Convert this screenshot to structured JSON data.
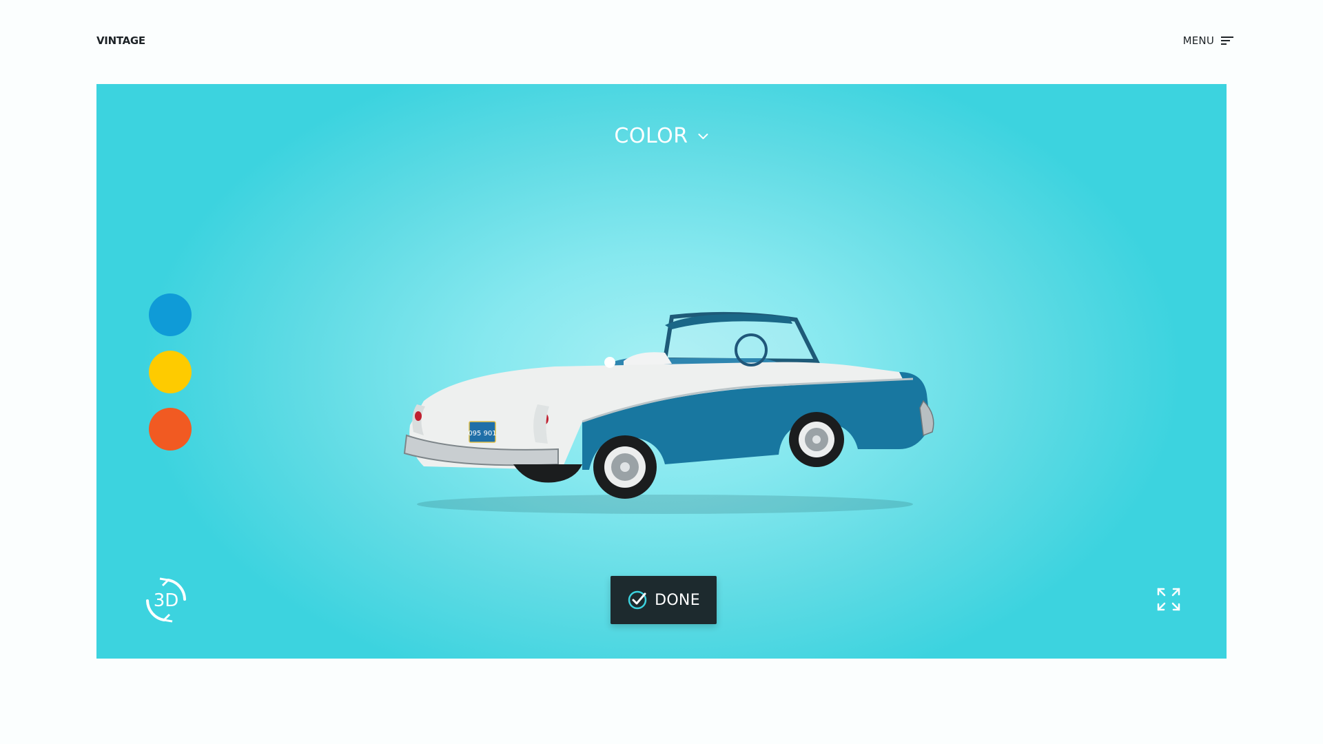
{
  "header": {
    "brand": "VINTAGE",
    "menu_label": "MENU",
    "menu_icon": "hamburger-menu-icon"
  },
  "configurator": {
    "option_title": "COLOR",
    "option_icon": "chevron-down-icon",
    "swatches": [
      {
        "name": "blue",
        "color": "#0f9bd7"
      },
      {
        "name": "yellow",
        "color": "#fecb00"
      },
      {
        "name": "orange",
        "color": "#f15a22"
      }
    ],
    "product_image": {
      "subject": "vintage convertible car, blue and white",
      "plate_text": "095 901"
    },
    "view_3d_label": "3D",
    "view_3d_icon": "rotate-3d-icon",
    "done_label": "DONE",
    "done_icon": "check-circle-icon",
    "fullscreen_icon": "expand-icon"
  },
  "colors": {
    "stage_bg": "#3cd3df",
    "done_bg": "#1d2a2e",
    "text_dark": "#1c2226"
  }
}
